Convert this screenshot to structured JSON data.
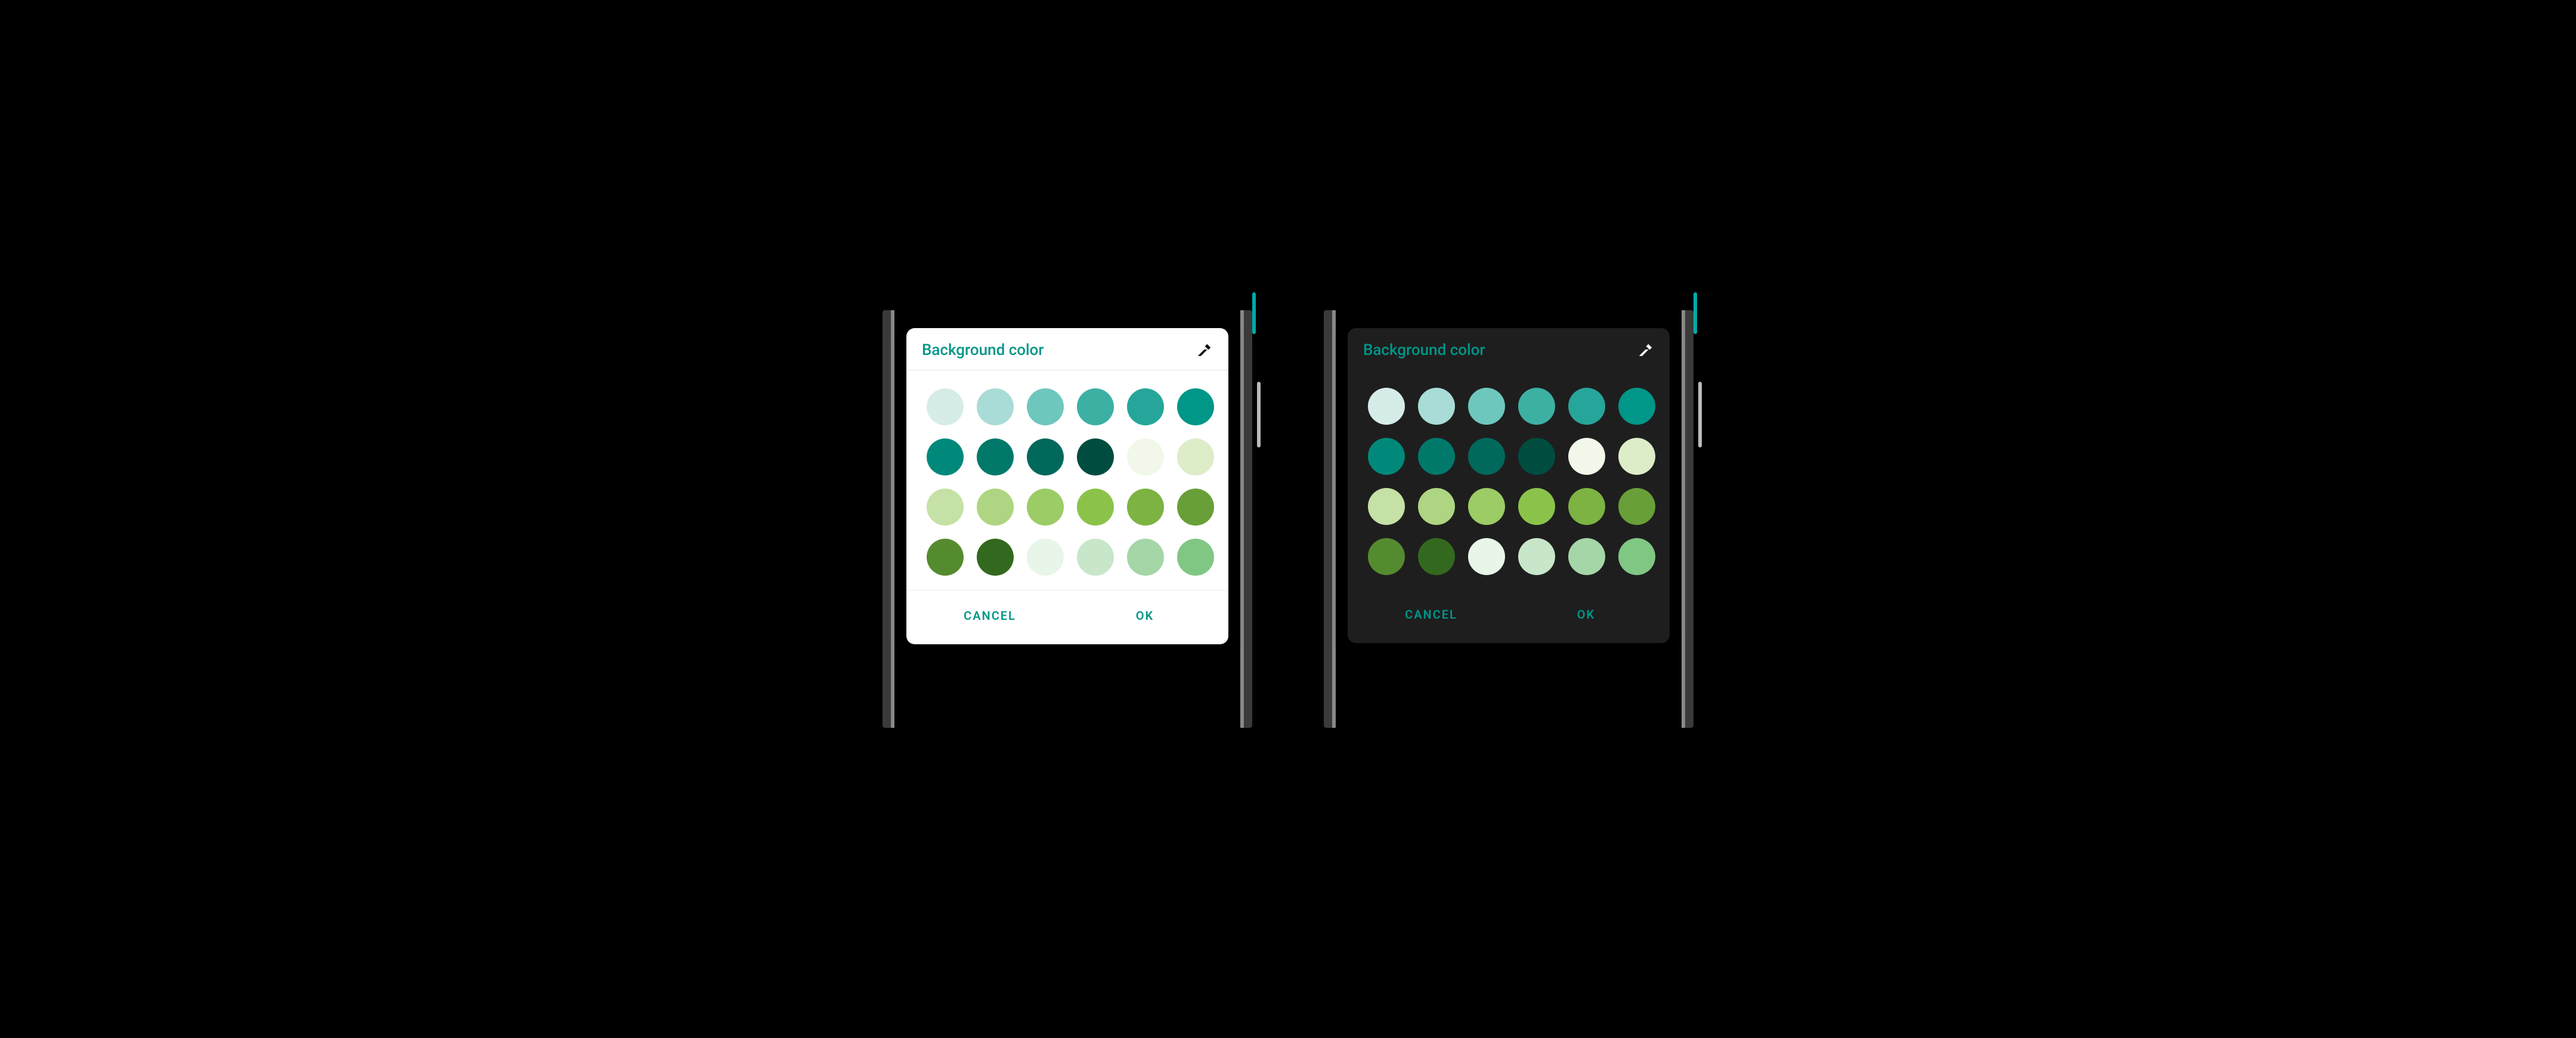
{
  "accent": "#009688",
  "dialog": {
    "title": "Background color",
    "cancel_label": "CANCEL",
    "ok_label": "OK",
    "eyedropper_icon": "eyedropper-icon"
  },
  "swatches": [
    "#d6ece9",
    "#a9dcd6",
    "#6ec7bd",
    "#3db0a4",
    "#26a69a",
    "#009688",
    "#00897b",
    "#00796b",
    "#00695c",
    "#004d40",
    "#f1f8e9",
    "#dcedc8",
    "#c5e1a5",
    "#aed581",
    "#9ccc65",
    "#8bc34a",
    "#7cb342",
    "#689f38",
    "#558b2f",
    "#33691e",
    "#e8f5e9",
    "#c8e6c9",
    "#a5d6a7",
    "#81c784"
  ],
  "themes": {
    "light": {
      "surface": "#ffffff"
    },
    "dark": {
      "surface": "#1e1e1e"
    }
  }
}
